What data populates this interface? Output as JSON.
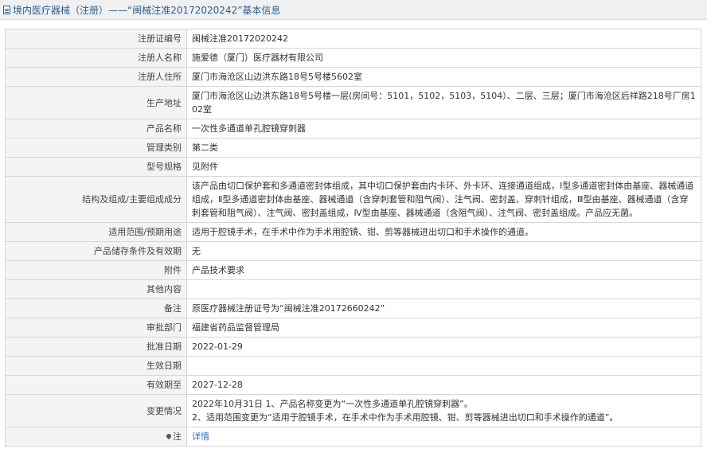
{
  "header": {
    "icon": "document-icon",
    "title": "境内医疗器械（注册）——“闽械注准20172020242”基本信息"
  },
  "rows": [
    {
      "label": "注册证编号",
      "value": "闽械注准20172020242"
    },
    {
      "label": "注册人名称",
      "value": "施爱德（厦门）医疗器材有限公司"
    },
    {
      "label": "注册人住所",
      "value": "厦门市海沧区山边洪东路18号5号楼5602室"
    },
    {
      "label": "生产地址",
      "value": "厦门市海沧区山边洪东路18号5号楼一层(房间号：5101，5102，5103，5104）、二层、三层；厦门市海沧区后祥路218号厂房102室"
    },
    {
      "label": "产品名称",
      "value": "一次性多通道单孔腔镜穿刺器"
    },
    {
      "label": "管理类别",
      "value": "第二类"
    },
    {
      "label": "型号规格",
      "value": "见附件"
    },
    {
      "label": "结构及组成/主要组成成分",
      "value": "该产品由切口保护套和多通道密封体组成，其中切口保护套由内卡环、外卡环、连接通道组成，Ⅰ型多通道密封体由基座、器械通道组成，Ⅱ型多通道密封体由基座、器械通道（含穿刺套管和阻气阀）、注气阀、密封盖、穿刺针组成，Ⅲ型由基座、器械通道（含穿刺套管和阻气阀）、注气阀、密封盖组成，Ⅳ型由基座、器械通道（含阻气阀）、注气阀、密封盖组成。产品应无菌。"
    },
    {
      "label": "适用范围/预期用途",
      "value": "适用于腔镜手术，在手术中作为手术用腔镜、钳、剪等器械进出切口和手术操作的通道。"
    },
    {
      "label": "产品储存条件及有效期",
      "value": "无"
    },
    {
      "label": "附件",
      "value": "产品技术要求"
    },
    {
      "label": "其他内容",
      "value": ""
    },
    {
      "label": "备注",
      "value": "原医疗器械注册证号为“闽械注准20172660242”"
    },
    {
      "label": "审批部门",
      "value": "福建省药品监督管理局"
    },
    {
      "label": "批准日期",
      "value": "2022-01-29"
    },
    {
      "label": "生效日期",
      "value": ""
    },
    {
      "label": "有效期至",
      "value": "2027-12-28"
    },
    {
      "label": "变更情况",
      "value_line1": "2022年10月31日 1、产品名称变更为“一次性多通道单孔腔镜穿刺器”。",
      "value_line2": "2、适用范围变更为“适用于腔镜手术，在手术中作为手术用腔镜、钳、剪等器械进出切口和手术操作的通道”。"
    },
    {
      "label": "注",
      "label_icon": "pin-icon",
      "link_text": "详情"
    }
  ],
  "colors": {
    "header_text": "#2f5f8a",
    "label_bg": "#f4f4f4",
    "border": "#d6d6d6",
    "link": "#2f6fb5"
  }
}
